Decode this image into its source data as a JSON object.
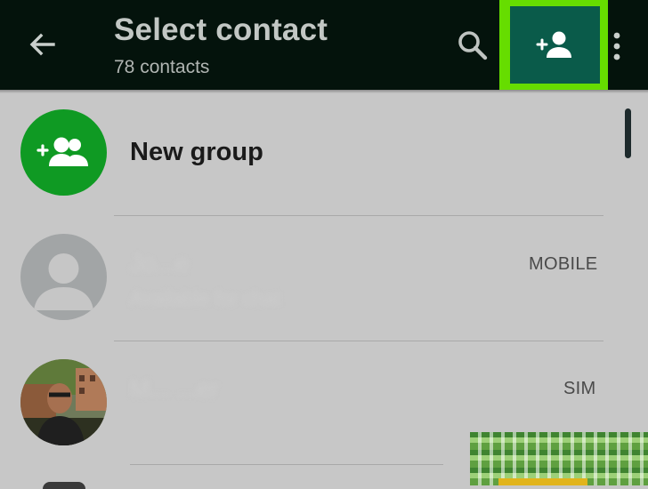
{
  "toolbar": {
    "title": "Select contact",
    "subtitle": "78 contacts",
    "back_icon": "arrow-left-icon",
    "search_icon": "search-icon",
    "add_contact_icon": "person-add-icon",
    "overflow_icon": "more-vertical-icon"
  },
  "list": {
    "new_group": {
      "label": "New group",
      "icon": "group-add-icon"
    },
    "contacts": [
      {
        "name": "Jo...e",
        "status": "Available for chat",
        "type": "MOBILE",
        "avatar": "default-avatar-icon"
      },
      {
        "name": "M... ...er",
        "status": "",
        "type": "SIM",
        "avatar": "photo-avatar"
      }
    ]
  },
  "colors": {
    "appbar": "#04130c",
    "highlight": "#66dd00",
    "add_button": "#0a5b4a",
    "group_avatar": "#0f9a23",
    "background": "#c7c7c7"
  }
}
